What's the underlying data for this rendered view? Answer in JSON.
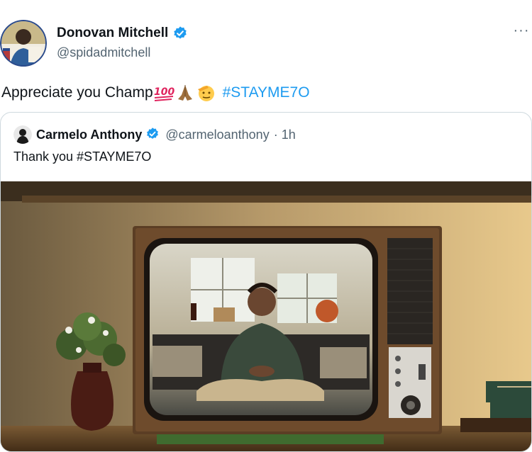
{
  "post": {
    "author_name": "Donovan Mitchell",
    "author_handle": "@spidadmitchell",
    "text": "Appreciate you Champ",
    "hashtag": "#STAYME7O",
    "more_label": "···"
  },
  "quoted_post": {
    "author_name": "Carmelo Anthony",
    "author_handle": "@carmeloanthony",
    "time": "· 1h",
    "text": "Thank you #STAYME7O"
  },
  "icons": {
    "verified": "verified-badge-icon",
    "more": "more-options-icon"
  },
  "colors": {
    "hashtag": "#1d9bf0",
    "verified": "#1d9bf0",
    "secondary_text": "#536471"
  }
}
